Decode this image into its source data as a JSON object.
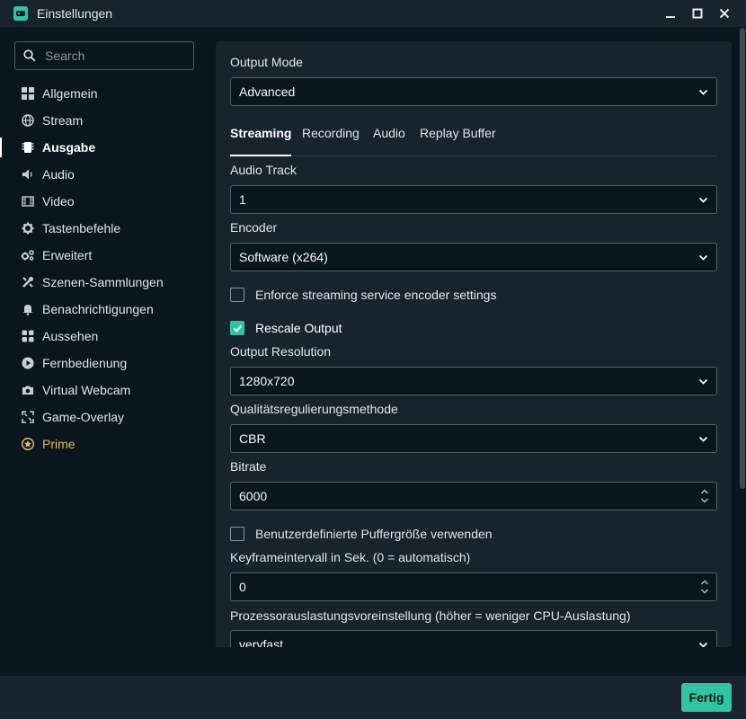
{
  "window": {
    "title": "Einstellungen"
  },
  "search": {
    "placeholder": "Search"
  },
  "sidebar": {
    "items": [
      {
        "label": "Allgemein",
        "icon": "grid-icon"
      },
      {
        "label": "Stream",
        "icon": "globe-icon"
      },
      {
        "label": "Ausgabe",
        "icon": "chip-icon",
        "active": true
      },
      {
        "label": "Audio",
        "icon": "speaker-icon"
      },
      {
        "label": "Video",
        "icon": "film-icon"
      },
      {
        "label": "Tastenbefehle",
        "icon": "gear-icon"
      },
      {
        "label": "Erweitert",
        "icon": "gears-icon"
      },
      {
        "label": "Szenen-Sammlungen",
        "icon": "tools-icon"
      },
      {
        "label": "Benachrichtigungen",
        "icon": "bell-icon"
      },
      {
        "label": "Aussehen",
        "icon": "apps-icon"
      },
      {
        "label": "Fernbedienung",
        "icon": "play-circle-icon"
      },
      {
        "label": "Virtual Webcam",
        "icon": "camera-icon"
      },
      {
        "label": "Game-Overlay",
        "icon": "expand-icon"
      },
      {
        "label": "Prime",
        "icon": "prime-icon"
      }
    ]
  },
  "main": {
    "output_mode": {
      "label": "Output Mode",
      "value": "Advanced"
    },
    "tabs": [
      {
        "label": "Streaming",
        "active": true
      },
      {
        "label": "Recording"
      },
      {
        "label": "Audio"
      },
      {
        "label": "Replay Buffer"
      }
    ],
    "audio_track": {
      "label": "Audio Track",
      "value": "1"
    },
    "encoder": {
      "label": "Encoder",
      "value": "Software (x264)"
    },
    "enforce": {
      "label": "Enforce streaming service encoder settings",
      "checked": false
    },
    "rescale": {
      "label": "Rescale Output",
      "checked": true
    },
    "resolution": {
      "label": "Output Resolution",
      "value": "1280x720"
    },
    "rate_control": {
      "label": "Qualitätsregulierungsmethode",
      "value": "CBR"
    },
    "bitrate": {
      "label": "Bitrate",
      "value": "6000"
    },
    "buffer": {
      "label": "Benutzerdefinierte Puffergröße verwenden",
      "checked": false
    },
    "keyframe": {
      "label": "Keyframeintervall in Sek. (0 = automatisch)",
      "value": "0"
    },
    "preset": {
      "label": "Prozessorauslastungsvoreinstellung (höher = weniger CPU-Auslastung)",
      "value": "veryfast"
    }
  },
  "footer": {
    "done_label": "Fertig"
  },
  "colors": {
    "accent": "#31c3a2",
    "background": "#09161d",
    "panel": "#17242d",
    "prime": "#e6b665"
  }
}
